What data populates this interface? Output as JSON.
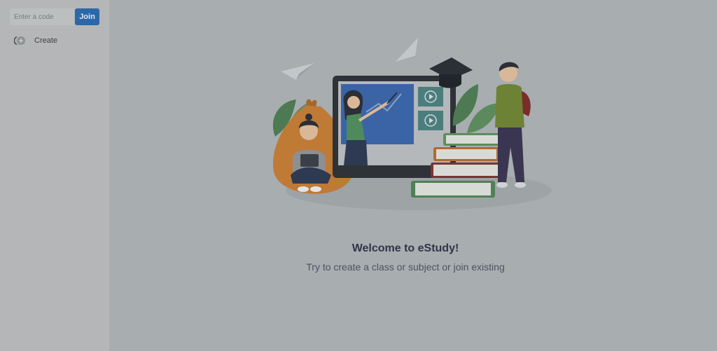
{
  "sidebar": {
    "code_input": {
      "placeholder": "Enter a code",
      "value": ""
    },
    "join_label": "Join",
    "create_label": "Create"
  },
  "main": {
    "welcome_title": "Welcome to eStudy!",
    "welcome_subtitle": "Try to create a class or subject or join existing"
  },
  "colors": {
    "overlay_bg": "#a8adb0",
    "sidebar_bg": "#b4b6b7",
    "join_button": "#2c68a8",
    "title_text": "#2f3548"
  },
  "icons": {
    "create": "plus-circle-icon",
    "illustration": "online-learning-illustration"
  }
}
